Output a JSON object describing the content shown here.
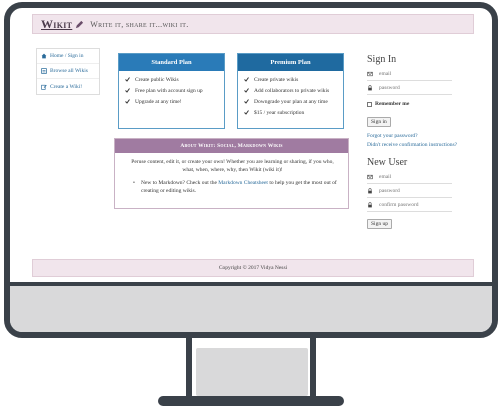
{
  "header": {
    "brand": "Wikit",
    "tagline": "Write it, share it...wiki it."
  },
  "nav": {
    "items": [
      {
        "label": "Home / Sign in",
        "icon": "home-icon"
      },
      {
        "label": "Browse all Wikis",
        "icon": "list-icon"
      },
      {
        "label": "Create a Wiki!",
        "icon": "edit-icon"
      }
    ]
  },
  "plans": {
    "standard": {
      "title": "Standard Plan",
      "features": [
        "Create public Wikis",
        "Free plan with account sign up",
        "Upgrade at any time!"
      ]
    },
    "premium": {
      "title": "Premium Plan",
      "features": [
        "Create private wikis",
        "Add collaborators to private wikis",
        "Downgrade your plan at any time",
        "$15 / year subscription"
      ]
    }
  },
  "about": {
    "title": "About Wikit: Social, Markdown Wikis",
    "intro": "Peruse content, edit it, or create your own! Whether you are learning or sharing, if you who, what, when, where, why, then Wikit (wiki it)!",
    "bullet_prefix": "New to Markdown? Check out the",
    "bullet_link": "Markdown Cheatsheet",
    "bullet_suffix": "to help you get the most out of creating or editing wikis."
  },
  "sign_in": {
    "title": "Sign In",
    "email_placeholder": "email",
    "password_placeholder": "password",
    "remember_label": "Remember me",
    "button": "Sign in",
    "forgot_link": "Forgot your password?",
    "confirm_link": "Didn't receive confirmation instructions?"
  },
  "new_user": {
    "title": "New User",
    "email_placeholder": "email",
    "password_placeholder": "password",
    "confirm_placeholder": "confirm password",
    "button": "Sign up"
  },
  "footer": {
    "text": "Copyright © 2017 Vidya Nessi"
  },
  "colors": {
    "header_bg": "#f1e5ec",
    "plan_head": "#2a7bb8",
    "about_head": "#a07ba1",
    "link": "#2a6b9a",
    "frame": "#3a4149"
  }
}
